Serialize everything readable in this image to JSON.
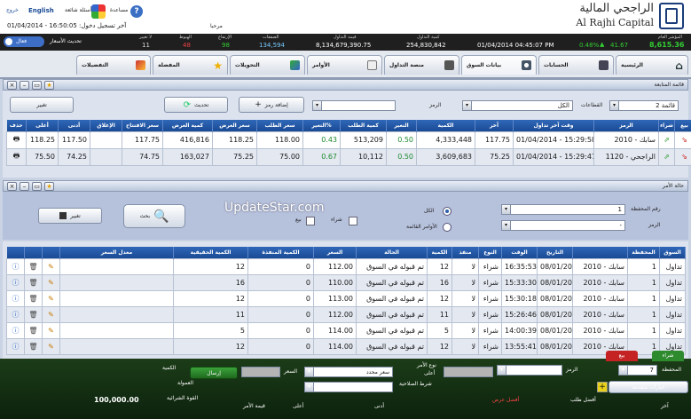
{
  "header": {
    "logo_arabic": "الراجحي المالية",
    "logo_english": "Al Rajhi Capital",
    "help_label": "مساعدة",
    "faq_label": "أسئلة شائعة",
    "english_link": "English",
    "logout_link": "خروج",
    "last_login_label": "آخر تسجيل دخول: 16:50:05 - 01/04/2014",
    "prices_update_label": "تحديث الأسعار",
    "toggle_label": "فعال",
    "update_label_cell": "مرحبا"
  },
  "ticker": {
    "index_label": "المؤشر العام",
    "index_value": "8,615.36",
    "change_value": "41.67",
    "change_pct": "0.48%",
    "datetime": "01/04/2014 04:45:07 PM",
    "volume_label": "كمية التداول",
    "volume_value": "254,830,842",
    "value_label": "قيمة التداول",
    "value_value": "8,134,679,390.75",
    "trades_label": "الصفقات",
    "trades_value": "134,594",
    "up_label": "الإرتفاع",
    "up_value": "98",
    "down_label": "الهبوط",
    "down_value": "48",
    "unchanged_label": "لا تغيير",
    "unchanged_value": "11"
  },
  "tabs": [
    {
      "label": "الرئيسية",
      "icon": "home-icon"
    },
    {
      "label": "الحسابات",
      "icon": "accounts-icon"
    },
    {
      "label": "بيانات السوق",
      "icon": "market-data-icon"
    },
    {
      "label": "منصة التداول",
      "icon": "trading-icon"
    },
    {
      "label": "الأوامر",
      "icon": "orders-icon"
    },
    {
      "label": "التحويلات",
      "icon": "transfers-icon"
    },
    {
      "label": "المفضلة",
      "icon": "star-icon"
    },
    {
      "label": "التفضيلات",
      "icon": "preferences-icon"
    }
  ],
  "watchlist": {
    "title": "قائمة المتابعة",
    "list_select": "قائمة 2",
    "sectors_label": "القطاعات",
    "sectors_value": "الكل",
    "symbol_label": "الرمز",
    "add_symbol_btn": "إضافة رمز",
    "update_btn": "تحديث",
    "change_btn": "تغيير",
    "columns": [
      "بيع",
      "شراء",
      "الرمز",
      "وقت آخر تداول",
      "آخر",
      "الكمية",
      "التغير",
      "كمية الطلب",
      "التغير%",
      "سعر الطلب",
      "سعر العرض",
      "كمية العرض",
      "سعر الافتتاح",
      "الإغلاق",
      "أدنى",
      "أعلى",
      "حذف"
    ],
    "rows": [
      {
        "symbol": "2010 - سابك",
        "time": "01/04/2014 - 15:29:58",
        "last": "117.75",
        "qty": "4,333,448",
        "change": "0.50",
        "bid_qty": "513,209",
        "change_pct": "0.43",
        "bid": "118.00",
        "ask": "118.25",
        "ask_qty": "416,816",
        "open": "117.75",
        "close": "",
        "low": "117.50",
        "high": "118.25"
      },
      {
        "symbol": "1120 - الراجحي",
        "time": "01/04/2014 - 15:29:47",
        "last": "75.25",
        "qty": "3,609,683",
        "change": "0.50",
        "bid_qty": "10,112",
        "change_pct": "0.67",
        "bid": "75.00",
        "ask": "75.25",
        "ask_qty": "163,027",
        "open": "74.75",
        "close": "",
        "low": "74.25",
        "high": "75.50"
      }
    ]
  },
  "orders": {
    "title": "حالة الأمر",
    "portfolio_label": "رقم المحفظة",
    "portfolio_value": "1",
    "symbol_label": "الرمز",
    "symbol_value": "-",
    "all_label": "الكل",
    "open_orders_label": "الأوامر القائمة",
    "buy_label": "شراء",
    "sell_label": "بيع",
    "search_btn": "بحث",
    "change_btn": "تغيير",
    "watermark": "UpdateStar.com",
    "columns": [
      "السوق",
      "المحفظة",
      "التاريخ",
      "الوقت",
      "النوع",
      "منفذ",
      "الكمية",
      "الحالة",
      "السعر",
      "الكمية المنفذة",
      "الكمية الحقيقية",
      "معدل السعر"
    ],
    "rows": [
      {
        "market": "تداول",
        "symbol": "2010 - سابك",
        "portfolio": "1",
        "date": "08/01/2013",
        "time": "16:35:53",
        "type": "شراء",
        "exec": "لا",
        "qty": "12",
        "status": "تم قبوله في السوق",
        "price": "112.00",
        "filled": "0",
        "real_qty": "12",
        "avg": ""
      },
      {
        "market": "تداول",
        "symbol": "2010 - سابك",
        "portfolio": "1",
        "date": "08/01/2013",
        "time": "15:33:30",
        "type": "شراء",
        "exec": "لا",
        "qty": "16",
        "status": "تم قبوله في السوق",
        "price": "110.00",
        "filled": "0",
        "real_qty": "16",
        "avg": ""
      },
      {
        "market": "تداول",
        "symbol": "2010 - سابك",
        "portfolio": "1",
        "date": "08/01/2013",
        "time": "15:30:18",
        "type": "شراء",
        "exec": "لا",
        "qty": "12",
        "status": "تم قبوله في السوق",
        "price": "113.00",
        "filled": "0",
        "real_qty": "12",
        "avg": ""
      },
      {
        "market": "تداول",
        "symbol": "2010 - سابك",
        "portfolio": "1",
        "date": "08/01/2013",
        "time": "15:26:46",
        "type": "شراء",
        "exec": "لا",
        "qty": "11",
        "status": "تم قبوله في السوق",
        "price": "112.00",
        "filled": "0",
        "real_qty": "11",
        "avg": ""
      },
      {
        "market": "تداول",
        "symbol": "2010 - سابك",
        "portfolio": "1",
        "date": "08/01/2013",
        "time": "14:00:39",
        "type": "شراء",
        "exec": "لا",
        "qty": "5",
        "status": "تم قبوله في السوق",
        "price": "114.00",
        "filled": "0",
        "real_qty": "5",
        "avg": ""
      },
      {
        "market": "تداول",
        "symbol": "2010 - سابك",
        "portfolio": "1",
        "date": "08/01/2013",
        "time": "13:55:41",
        "type": "شراء",
        "exec": "لا",
        "qty": "12",
        "status": "تم قبوله في السوق",
        "price": "114.00",
        "filled": "0",
        "real_qty": "12",
        "avg": ""
      }
    ]
  },
  "order_form": {
    "buy_tab": "شراء",
    "sell_tab": "بيع",
    "portfolio_label": "المحفظة",
    "portfolio_value": "7",
    "symbol_label": "الرمز",
    "order_type_label": "نوع الأمر",
    "order_type_value": "سعر محدد",
    "price_label": "السعر",
    "qty_label": "الكمية",
    "validity_label": "شرط الصلاحية",
    "send_btn": "إرسال",
    "advanced_btn": "خيارات متقدمة",
    "high_label": "أعلى",
    "low_label": "أدنى",
    "last_label": "آخر",
    "ask_label": "أفضل عرض",
    "bid_label": "أفضل طلب",
    "commission_label": "العمولة",
    "purchasing_power_label": "القوة الشرائية",
    "purchasing_power_value": "100,000.00",
    "order_total_label": "قيمة الأمر"
  },
  "colors": {
    "accent": "#1a4a94",
    "up": "#1e8a2e",
    "down": "#cc2222"
  }
}
